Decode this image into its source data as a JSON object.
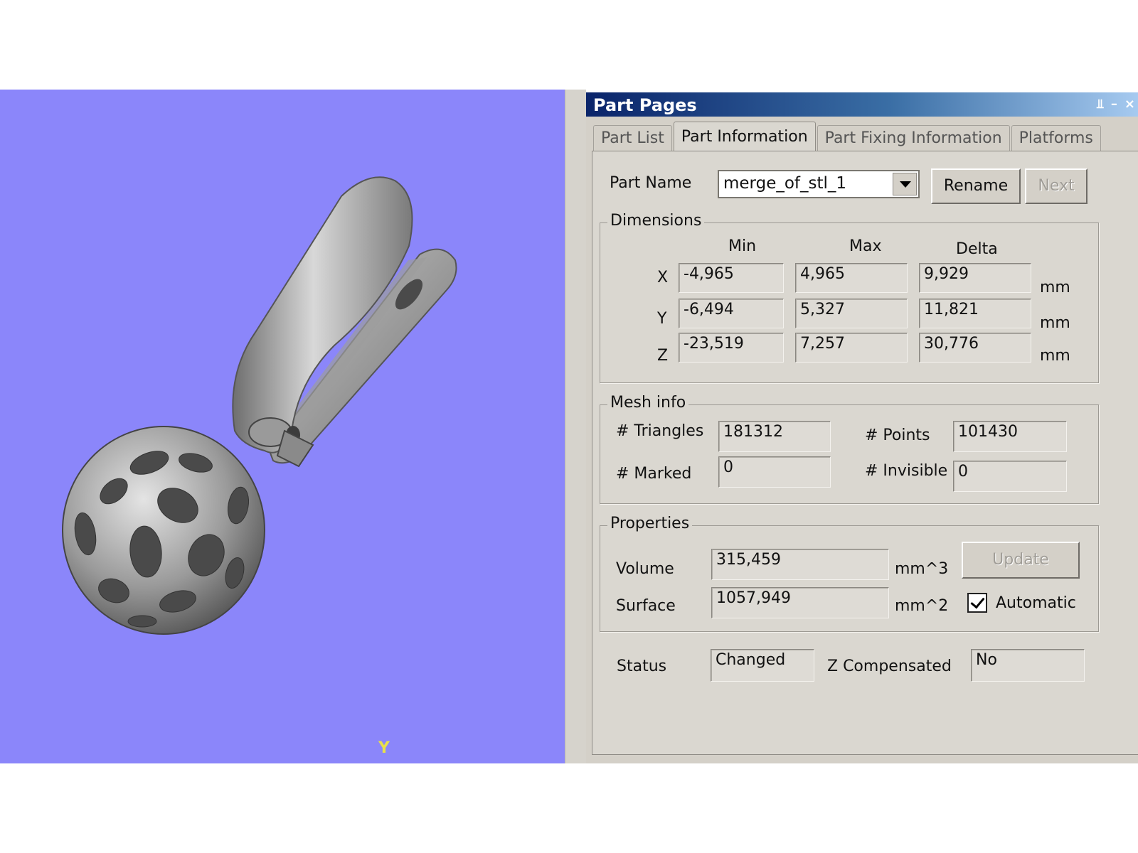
{
  "panel": {
    "title": "Part Pages",
    "tabs": [
      {
        "label": "Part List"
      },
      {
        "label": "Part Information"
      },
      {
        "label": "Part Fixing Information"
      },
      {
        "label": "Platforms"
      }
    ],
    "part_name_label": "Part Name",
    "part_name_value": "merge_of_stl_1",
    "rename_label": "Rename",
    "next_label": "Next",
    "dimensions": {
      "title": "Dimensions",
      "col_min": "Min",
      "col_max": "Max",
      "col_delta": "Delta",
      "unit": "mm",
      "rows": [
        {
          "axis": "X",
          "min": "-4,965",
          "max": "4,965",
          "delta": "9,929"
        },
        {
          "axis": "Y",
          "min": "-6,494",
          "max": "5,327",
          "delta": "11,821"
        },
        {
          "axis": "Z",
          "min": "-23,519",
          "max": "7,257",
          "delta": "30,776"
        }
      ]
    },
    "mesh_info": {
      "title": "Mesh info",
      "triangles_label": "# Triangles",
      "triangles_value": "181312",
      "points_label": "# Points",
      "points_value": "101430",
      "marked_label": "# Marked",
      "marked_value": "0",
      "invisible_label": "# Invisible",
      "invisible_value": "0"
    },
    "properties": {
      "title": "Properties",
      "volume_label": "Volume",
      "volume_value": "315,459",
      "volume_unit": "mm^3",
      "surface_label": "Surface",
      "surface_value": "1057,949",
      "surface_unit": "mm^2",
      "update_label": "Update",
      "automatic_label": "Automatic",
      "automatic_checked": true
    },
    "status": {
      "status_label": "Status",
      "status_value": "Changed",
      "zcomp_label": "Z Compensated",
      "zcomp_value": "No"
    }
  },
  "viewport": {
    "axis_label": "Y",
    "background": "#8b86fa"
  }
}
